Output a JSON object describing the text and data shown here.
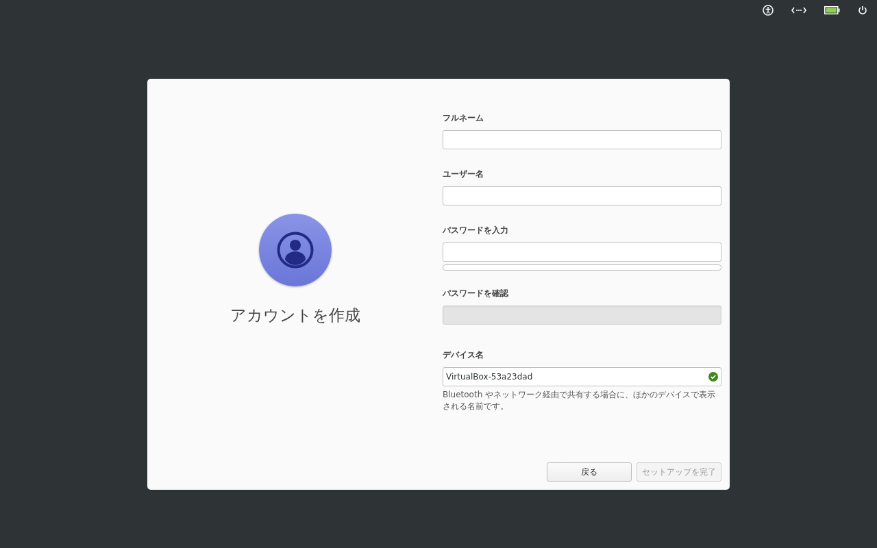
{
  "dialog": {
    "title": "アカウントを作成",
    "fields": [
      {
        "label": "フルネーム",
        "kind": "text",
        "disabled": false
      },
      {
        "label": "ユーザー名",
        "kind": "text",
        "disabled": false
      },
      {
        "label": "パスワードを入力",
        "kind": "password",
        "disabled": false,
        "strength": {
          "level": 0
        }
      },
      {
        "label": "パスワードを確認",
        "kind": "password",
        "disabled": true
      },
      {
        "label": "デバイス名",
        "kind": "text",
        "disabled": false,
        "value": "VirtualBox-53a23dad",
        "valid": true,
        "hint": "Bluetooth やネットワーク経由で共有する場合に、ほかのデバイスで表示される名前です。"
      }
    ],
    "buttons": [
      {
        "label": "戻る",
        "disabled": false
      },
      {
        "label": "セットアップを完了",
        "disabled": true
      }
    ]
  }
}
